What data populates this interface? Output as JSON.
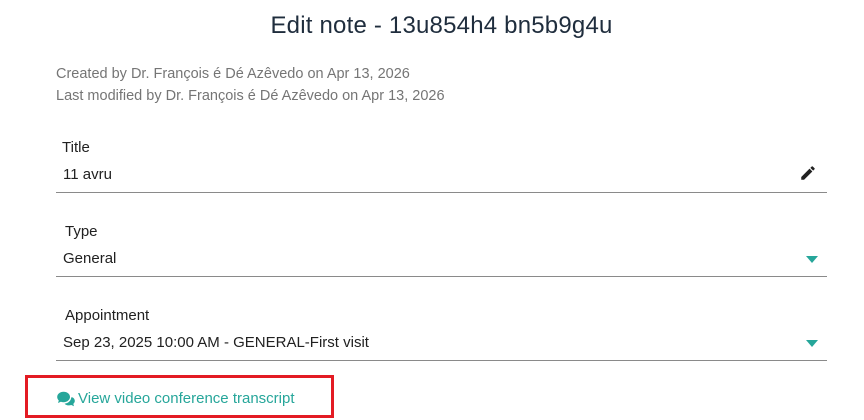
{
  "page": {
    "title": "Edit note - 13u854h4 bn5b9g4u",
    "created": "Created by Dr. François é Dé Azêvedo on Apr 13, 2026",
    "modified": "Last modified by Dr. François é Dé Azêvedo on Apr 13, 2026"
  },
  "fields": {
    "title": {
      "label": "Title",
      "value": "11 avru",
      "icon": "pencil-icon"
    },
    "type": {
      "label": "Type",
      "value": "General",
      "icon": "dropdown-arrow-icon"
    },
    "appointment": {
      "label": "Appointment",
      "value": "Sep 23, 2025 10:00 AM - GENERAL-First visit",
      "icon": "dropdown-arrow-icon"
    }
  },
  "transcript": {
    "label": "View video conference transcript",
    "icon": "chat-bubbles-icon"
  },
  "colors": {
    "accent": "#26a69a",
    "highlight_border": "#e31b23",
    "muted_text": "#757575"
  }
}
